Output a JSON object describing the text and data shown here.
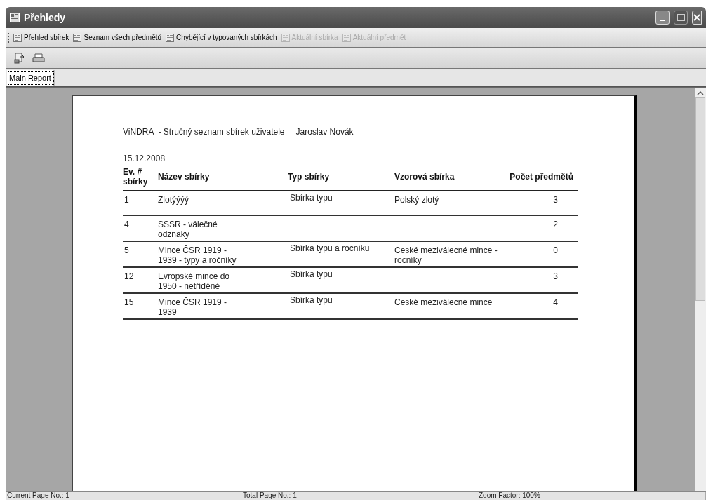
{
  "window": {
    "title": "Přehledy"
  },
  "toolbar": [
    {
      "label": "Přehled sbírek",
      "disabled": false
    },
    {
      "label": "Seznam všech předmětů",
      "disabled": false
    },
    {
      "label": "Chybějící v typovaných sbírkách",
      "disabled": false
    },
    {
      "label": "Aktuální sbírka",
      "disabled": true
    },
    {
      "label": "Aktuální předmět",
      "disabled": true
    }
  ],
  "tabs": [
    {
      "label": "Main Report",
      "selected": true
    }
  ],
  "report": {
    "title": "ViNDRA  - Stručný seznam sbírek uživatele",
    "user": "Jaroslav Novák",
    "date": "15.12.2008",
    "columns": [
      "Ev. # sbírky",
      "Název sbírky",
      "Typ sbírky",
      "Vzorová sbírka",
      "Počet předmětů"
    ],
    "rows": [
      [
        "1",
        "Zlotýýýý",
        "Sbírka typu",
        "Polský zlotý",
        "3"
      ],
      [
        "4",
        "SSSR - válečné odznaky",
        "",
        "",
        "2"
      ],
      [
        "5",
        "Mince ČSR 1919 - 1939 - typy a ročníky",
        "Sbírka typu a rocníku",
        "Ceské meziválecné mince - rocníky",
        "0"
      ],
      [
        "12",
        "Evropské mince do 1950 - netříděné",
        "Sbírka typu",
        "",
        "3"
      ],
      [
        "15",
        "Mince ČSR 1919 - 1939",
        "Sbírka typu",
        "Ceské meziválecné mince",
        "4"
      ]
    ]
  },
  "status_bar": [
    "Current Page No.: 1",
    "Total Page No.: 1",
    "Zoom Factor: 100%"
  ]
}
